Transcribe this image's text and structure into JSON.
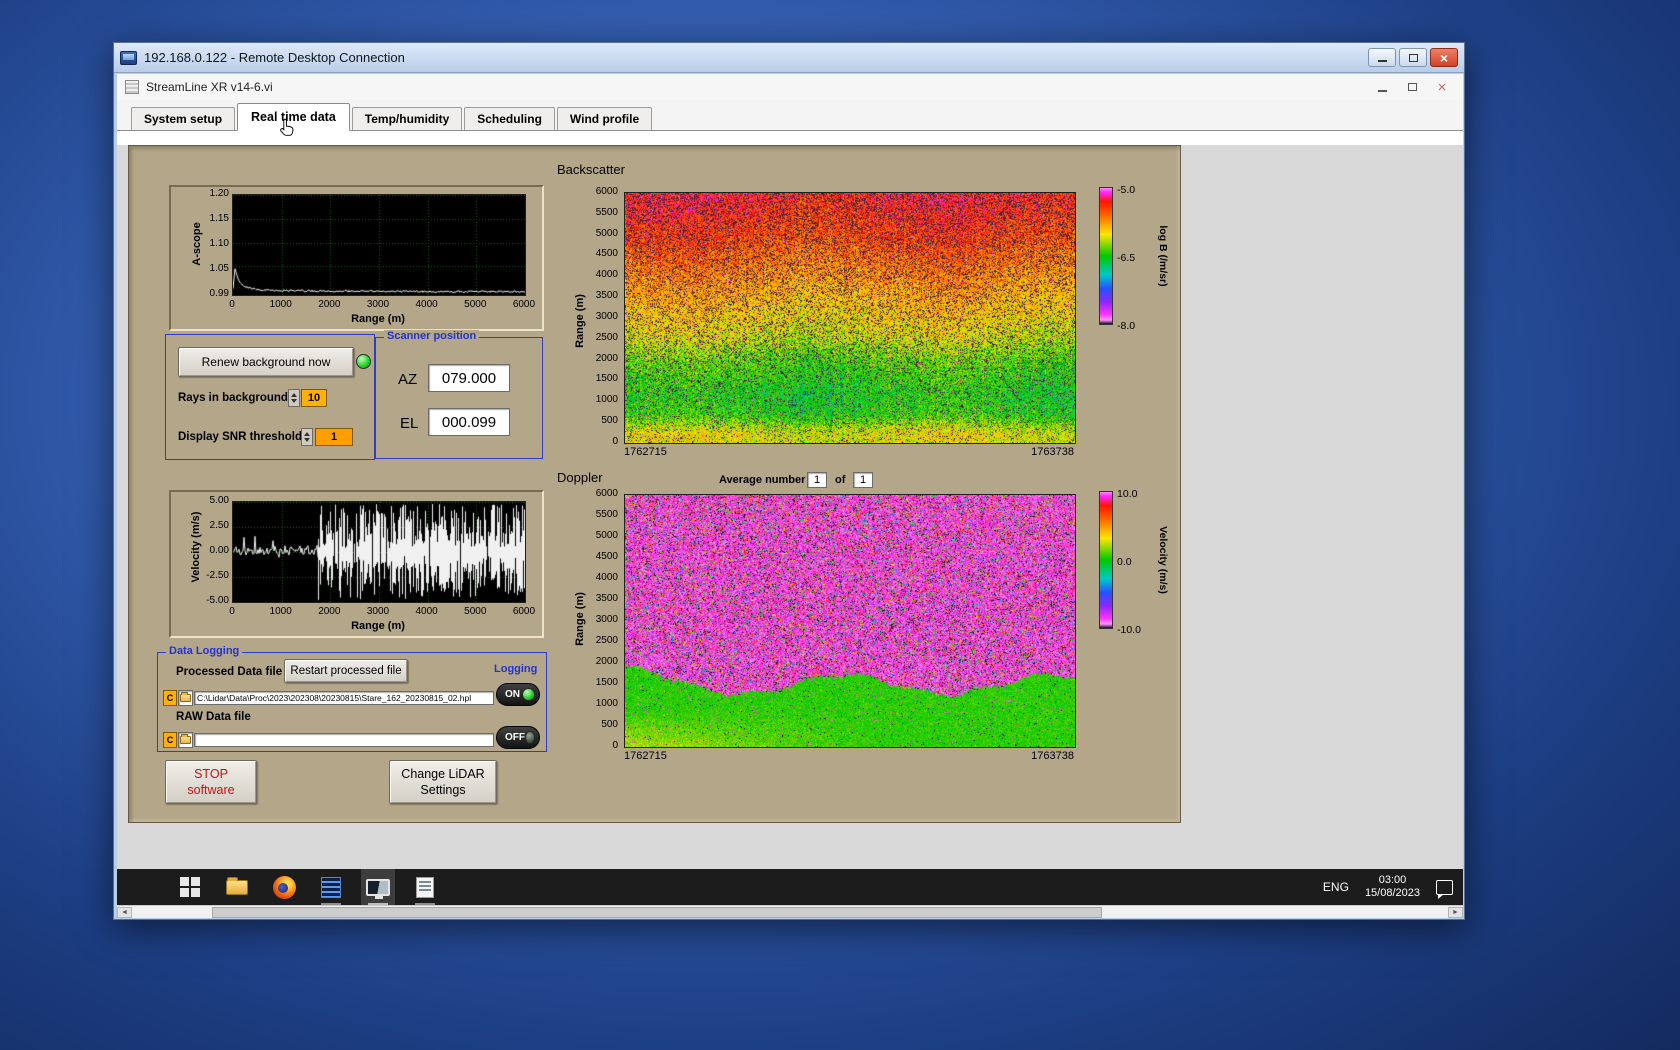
{
  "rdp": {
    "title": "192.168.0.122 - Remote Desktop Connection"
  },
  "app": {
    "title": "StreamLine XR v14-6.vi",
    "active_tab": "Real time data",
    "tabs": [
      {
        "label": "System setup"
      },
      {
        "label": "Real time data"
      },
      {
        "label": "Temp/humidity"
      },
      {
        "label": "Scheduling"
      },
      {
        "label": "Wind profile"
      }
    ]
  },
  "ascope": {
    "y_label": "A-scope",
    "x_label": "Range (m)",
    "y_ticks": [
      "1.20",
      "1.15",
      "1.10",
      "1.05",
      "0.99"
    ],
    "x_ticks": [
      "0",
      "1000",
      "2000",
      "3000",
      "4000",
      "5000",
      "6000"
    ]
  },
  "background_controls": {
    "renew_button": "Renew background now",
    "rays_label": "Rays in background",
    "rays_value": "10",
    "snr_label": "Display SNR threshold",
    "snr_value": "1"
  },
  "scanner_position": {
    "title": "Scanner position",
    "az_label": "AZ",
    "az_value": "079.000",
    "el_label": "EL",
    "el_value": "000.099"
  },
  "backscatter": {
    "title": "Backscatter",
    "y_label": "Range (m)",
    "y_ticks": [
      "6000",
      "5500",
      "5000",
      "4500",
      "4000",
      "3500",
      "3000",
      "2500",
      "2000",
      "1500",
      "1000",
      "500",
      "0"
    ],
    "time_start": "1762715",
    "time_end": "1763738",
    "colorbar_ticks": [
      "-5.0",
      "-6.5",
      "-8.0"
    ],
    "colorbar_label": "log B (/m/sr)"
  },
  "doppler": {
    "title": "Doppler",
    "average_label": "Average number",
    "average_value": "1",
    "of_label": "of",
    "average_total": "1",
    "y_label": "Range (m)",
    "y_ticks": [
      "6000",
      "5500",
      "5000",
      "4500",
      "4000",
      "3500",
      "3000",
      "2500",
      "2000",
      "1500",
      "1000",
      "500",
      "0"
    ],
    "time_start": "1762715",
    "time_end": "1763738",
    "colorbar_ticks": [
      "10.0",
      "0.0",
      "-10.0"
    ],
    "colorbar_label": "Velocity (m/s)"
  },
  "velocity_scope": {
    "y_label": "Velocity (m/s)",
    "x_label": "Range (m)",
    "y_ticks": [
      "5.00",
      "2.50",
      "0.00",
      "-2.50",
      "-5.00"
    ],
    "x_ticks": [
      "0",
      "1000",
      "2000",
      "3000",
      "4000",
      "5000",
      "6000"
    ]
  },
  "data_logging": {
    "title": "Data Logging",
    "processed_label": "Processed Data file",
    "restart_button": "Restart processed file",
    "logging_label": "Logging",
    "drive_letter": "C",
    "processed_path": "C:\\Lidar\\Data\\Proc\\2023\\202308\\20230815\\Stare_162_20230815_02.hpl",
    "raw_label": "RAW Data file",
    "raw_path": "",
    "on_label": "ON",
    "off_label": "OFF"
  },
  "footer_buttons": {
    "stop_line1": "STOP",
    "stop_line2": "software",
    "change_line1": "Change LiDAR",
    "change_line2": "Settings"
  },
  "taskbar": {
    "language": "ENG",
    "time": "03:00",
    "date": "15/08/2023"
  },
  "palette": [
    [
      0,
      "#ff8cff"
    ],
    [
      0.03,
      "#ff28ff"
    ],
    [
      0.1,
      "#ff1400"
    ],
    [
      0.22,
      "#ff7800"
    ],
    [
      0.34,
      "#ffe600"
    ],
    [
      0.5,
      "#00c800"
    ],
    [
      0.64,
      "#00c8c8"
    ],
    [
      0.74,
      "#2850ff"
    ],
    [
      0.84,
      "#8c28ff"
    ],
    [
      0.93,
      "#ff32ff"
    ],
    [
      0.97,
      "#ff96ff"
    ],
    [
      1,
      "#1e0a1e"
    ]
  ],
  "chart_data": [
    {
      "id": "ascope",
      "type": "line",
      "title": "A-scope",
      "xlabel": "Range (m)",
      "ylabel": "A-scope",
      "xlim": [
        0,
        6000
      ],
      "ylim": [
        0.99,
        1.2
      ],
      "grid_y": [
        1.2,
        1.15,
        1.1,
        1.05
      ],
      "x": [
        0,
        40,
        90,
        150,
        250,
        400,
        700,
        1200,
        2000,
        3000,
        4000,
        5000,
        6000
      ],
      "y": [
        1.005,
        1.046,
        1.028,
        1.015,
        1.008,
        1.003,
        1.0,
        0.999,
        0.998,
        0.998,
        0.997,
        0.997,
        0.997
      ],
      "grid_color": "#1c5a1c",
      "line_color": "#f0f0f0",
      "bg": "#000000"
    },
    {
      "id": "velocity",
      "type": "line",
      "title": "Velocity scope",
      "xlabel": "Range (m)",
      "ylabel": "Velocity (m/s)",
      "xlim": [
        0,
        6000
      ],
      "ylim": [
        -5,
        5
      ],
      "grid_y": [
        5,
        2.5,
        0,
        -2.5,
        -5
      ],
      "signal_region": [
        0,
        1750
      ],
      "signal_mean": 0.2,
      "signal_noise": 0.5,
      "noise_region": [
        1750,
        6000
      ],
      "grid_color": "#1c5a1c",
      "line_color": "#f0f0f0",
      "bg": "#000000"
    },
    {
      "id": "backscatter",
      "type": "heatmap",
      "title": "Backscatter",
      "x_start": 1762715,
      "x_end": 1763738,
      "ylabel": "Range (m)",
      "ylim": [
        0,
        6000
      ],
      "zlabel": "log B (/m/sr)",
      "zlim": [
        -8,
        -5
      ],
      "profile_alt": [
        0,
        200,
        400,
        700,
        1200,
        2000,
        2600,
        3200,
        3800,
        4400,
        5000,
        6000
      ],
      "profile_val": [
        -6.1,
        -6.05,
        -6.2,
        -6.45,
        -6.5,
        -6.35,
        -6.1,
        -5.95,
        -5.8,
        -5.65,
        -5.5,
        -5.35
      ],
      "noise": 0.25,
      "speck_base": 0.1,
      "speck_alt_gain": 0.2
    },
    {
      "id": "doppler",
      "type": "heatmap",
      "title": "Doppler",
      "x_start": 1762715,
      "x_end": 1763738,
      "ylabel": "Range (m)",
      "ylim": [
        0,
        6000
      ],
      "zlabel": "Velocity (m/s)",
      "zlim": [
        -10,
        10
      ],
      "aerosol_top_mean": 1500,
      "aerosol_top_wave": 230,
      "signal_mean": 0.5,
      "signal_noise": 0.9
    }
  ]
}
